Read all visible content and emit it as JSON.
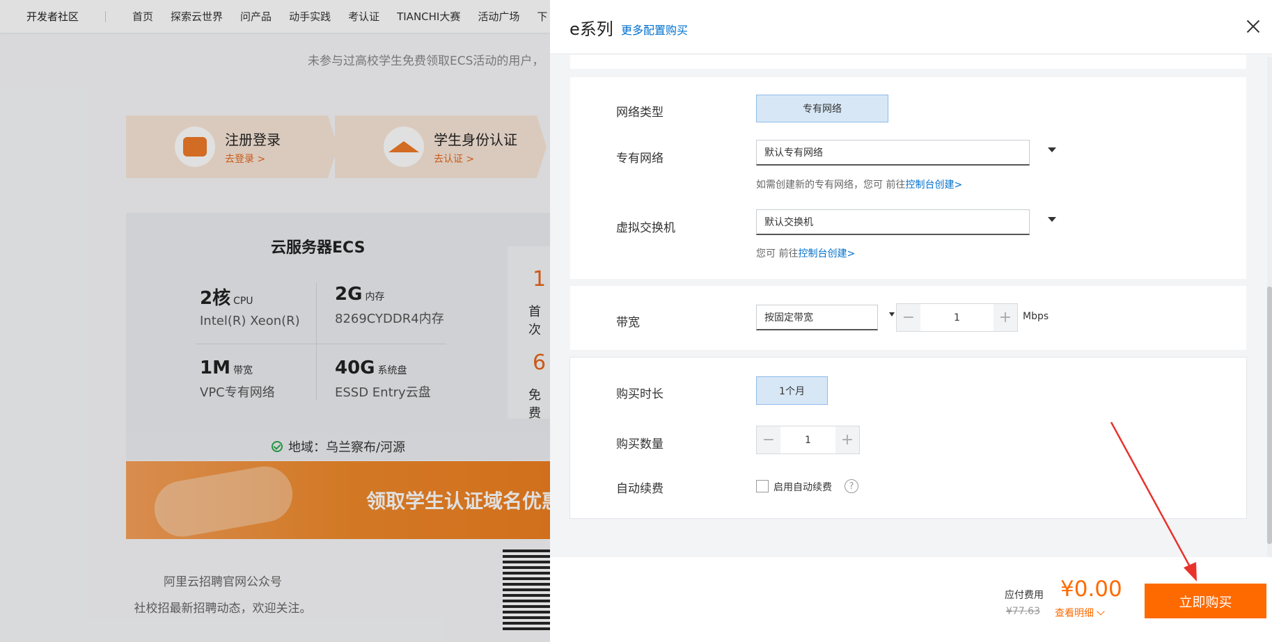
{
  "background": {
    "nav": {
      "brand": "开发者社区",
      "items": [
        "首页",
        "探索云世界",
        "问产品",
        "动手实践",
        "考认证",
        "TIANCHI大赛",
        "活动广场",
        "下"
      ]
    },
    "tip": "未参与过高校学生免费领取ECS活动的用户，",
    "steps": [
      {
        "title": "注册登录",
        "link": "去登录 >"
      },
      {
        "title": "学生身份认证",
        "link": "去认证 >"
      }
    ],
    "ecs": {
      "title": "云服务器ECS",
      "specs": [
        {
          "big": "2核",
          "unit": "CPU",
          "sub": "Intel(R) Xeon(R)"
        },
        {
          "big": "2G",
          "unit": "内存",
          "sub": "8269CYDDR4内存"
        },
        {
          "big": "1M",
          "unit": "带宽",
          "sub": "VPC专有网络"
        },
        {
          "big": "40G",
          "unit": "系统盘",
          "sub": "ESSD Entry云盘"
        }
      ],
      "side": [
        "1",
        "首次",
        "6",
        "免费"
      ]
    },
    "region": "地域：乌兰察布/河源",
    "promo": "领取学生认证域名优惠",
    "footer_line1": "阿里云招聘官网公众号",
    "footer_line2": "社校招最新招聘动态，欢迎关注。"
  },
  "drawer": {
    "title": "e系列",
    "more_link": "更多配置购买",
    "network_type": {
      "label": "网络类型",
      "value": "专有网络"
    },
    "vpc": {
      "label": "专有网络",
      "value": "默认专有网络",
      "hint_prefix": "如需创建新的专有网络，您可 前往",
      "hint_link": "控制台创建>"
    },
    "vswitch": {
      "label": "虚拟交换机",
      "value": "默认交换机",
      "hint_prefix": "您可 前往",
      "hint_link": "控制台创建>"
    },
    "bandwidth": {
      "label": "带宽",
      "mode": "按固定带宽",
      "value": "1",
      "unit": "Mbps"
    },
    "duration": {
      "label": "购买时长",
      "value": "1个月"
    },
    "quantity": {
      "label": "购买数量",
      "value": "1"
    },
    "auto_renew": {
      "label": "自动续费",
      "checkbox_label": "启用自动续费",
      "checked": false
    },
    "footer": {
      "fee_label": "应付费用",
      "fee_amount": "¥0.00",
      "original_price": "¥77.63",
      "detail_link": "查看明细",
      "buy_button": "立即购买"
    }
  },
  "colors": {
    "accent": "#ff6a00",
    "link": "#0070cc",
    "selected_bg": "#d7e7f6",
    "annotation_arrow": "#e8322b"
  }
}
